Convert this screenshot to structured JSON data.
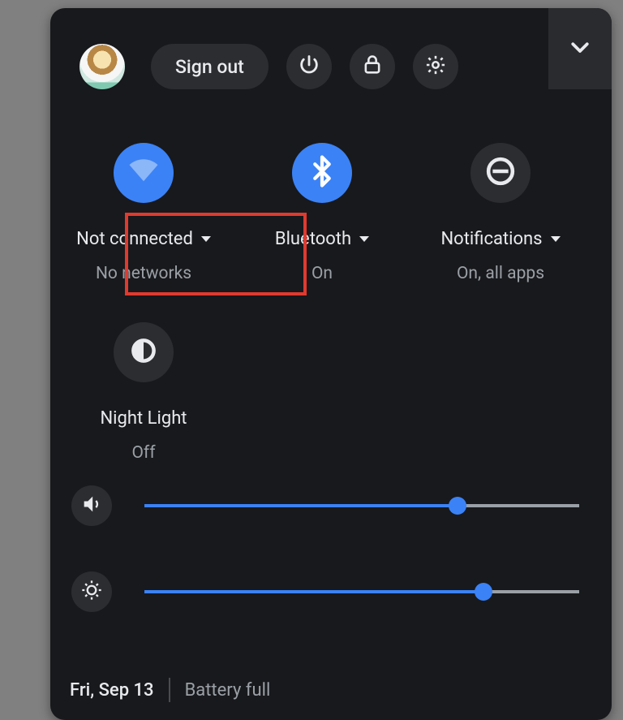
{
  "header": {
    "sign_out_label": "Sign out"
  },
  "tiles": {
    "wifi": {
      "title": "Not connected",
      "sub": "No networks"
    },
    "bluetooth": {
      "title": "Bluetooth",
      "sub": "On"
    },
    "notifications": {
      "title": "Notifications",
      "sub": "On, all apps"
    },
    "night_light": {
      "title": "Night Light",
      "sub": "Off"
    }
  },
  "sliders": {
    "volume": {
      "percent": 72
    },
    "brightness": {
      "percent": 78
    }
  },
  "footer": {
    "date": "Fri, Sep 13",
    "battery": "Battery full"
  },
  "colors": {
    "accent": "#3b82f6",
    "highlight_border": "#e03a2f"
  }
}
